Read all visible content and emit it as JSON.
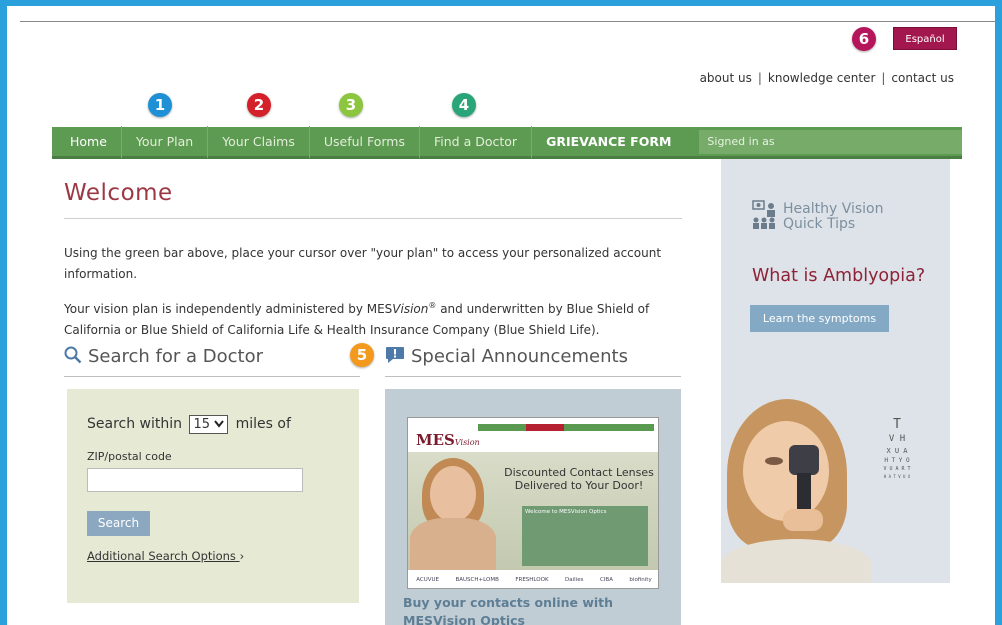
{
  "header": {
    "espanol_label": "Español",
    "top_links": [
      "about us",
      "knowledge center",
      "contact us"
    ],
    "top_links_separator": "|"
  },
  "callouts": {
    "c1": "1",
    "c2": "2",
    "c3": "3",
    "c4": "4",
    "c5": "5",
    "c6": "6",
    "colors": {
      "c1": "#1f8fd6",
      "c2": "#d4202a",
      "c3": "#8cc63e",
      "c4": "#2aa57a",
      "c5": "#f39a1e",
      "c6": "#b5155a"
    }
  },
  "nav": {
    "items": [
      "Home",
      "Your Plan",
      "Your Claims",
      "Useful Forms",
      "Find a Doctor",
      "GRIEVANCE FORM"
    ],
    "signed_in": "Signed in as",
    "color": "#5d9a52"
  },
  "main": {
    "title": "Welcome",
    "para1": "Using the green bar above, place your cursor over \"your plan\" to access your personalized account information.",
    "para2_a": "Your vision plan is independently administered by MES",
    "para2_brand": "Vision",
    "para2_reg": "®",
    "para2_b": " and underwritten by Blue Shield of California or Blue Shield of California Life & Health Insurance Company (Blue Shield Life)."
  },
  "search": {
    "heading": "Search for a Doctor",
    "within_label": "Search within",
    "miles_value": "15",
    "miles_label": "miles of",
    "zip_label": "ZIP/postal code",
    "zip_value": "",
    "button": "Search",
    "additional": "Additional Search Options",
    "additional_arrow": "›"
  },
  "announcements": {
    "heading": "Special Announcements",
    "caption": "Buy your contacts online with MESVision Optics",
    "inner": {
      "logo": "MES",
      "logo_sub": "Vision",
      "headline": "Discounted Contact Lenses Delivered to Your Door!",
      "welcome_box": "Welcome to MESVision Optics",
      "brands": [
        "ACUVUE",
        "BAUSCH+LOMB",
        "FRESHLOOK",
        "Dailies",
        "CIBA",
        "biofinity"
      ]
    }
  },
  "sidebar": {
    "tip_title_line1": "Healthy Vision",
    "tip_title_line2": "Quick Tips",
    "question": "What is Amblyopia?",
    "button": "Learn the symptoms",
    "eye_chart": [
      "T",
      "V H",
      "X U A",
      "H T Y O",
      "V U A R T",
      "H A T V U X"
    ]
  }
}
